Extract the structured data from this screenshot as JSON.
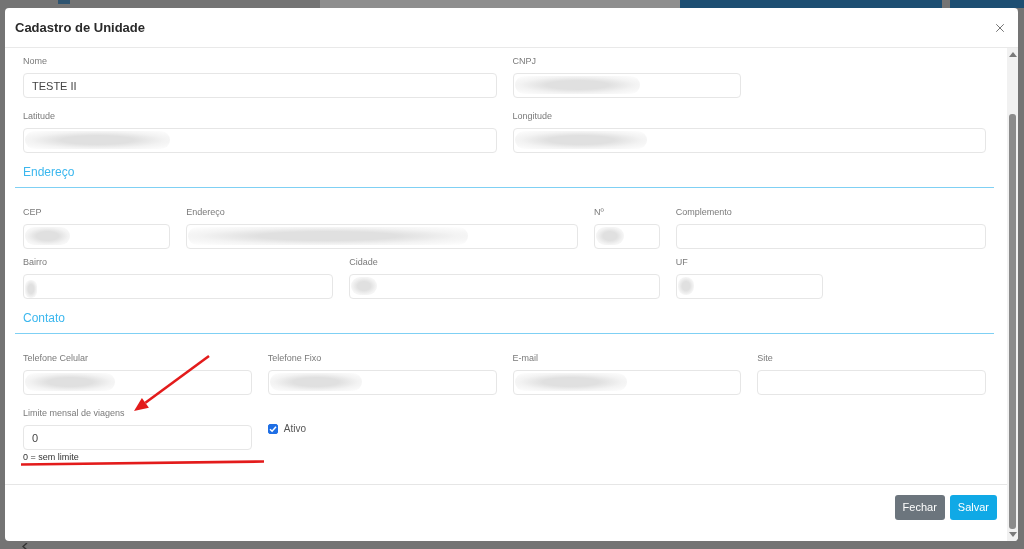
{
  "dialog": {
    "title": "Cadastro de Unidade"
  },
  "groups": [
    {
      "fields": [
        {
          "kind": "text",
          "label": "Nome",
          "value": "TESTE II",
          "blurred": false
        },
        {
          "kind": "text",
          "label": "CNPJ",
          "blurred": true
        },
        {
          "kind": "text",
          "label": "Latitude",
          "blurred": true
        },
        {
          "kind": "text",
          "label": "Longitude",
          "blurred": true
        }
      ]
    },
    {
      "title": "Endereço",
      "fields": [
        {
          "kind": "text",
          "label": "CEP",
          "blurred": true
        },
        {
          "kind": "text",
          "label": "Endereço",
          "blurred": true
        },
        {
          "kind": "text",
          "label": "Nº",
          "blurred": true
        },
        {
          "kind": "text",
          "label": "Complemento",
          "blurred": false
        },
        {
          "kind": "text",
          "label": "Bairro",
          "blurred": true
        },
        {
          "kind": "text",
          "label": "Cidade",
          "blurred": true
        },
        {
          "kind": "text",
          "label": "UF",
          "blurred": true
        }
      ]
    },
    {
      "title": "Contato",
      "fields": [
        {
          "kind": "text",
          "label": "Telefone Celular",
          "blurred": true
        },
        {
          "kind": "text",
          "label": "Telefone Fixo",
          "blurred": true
        },
        {
          "kind": "text",
          "label": "E-mail",
          "blurred": true
        },
        {
          "kind": "text",
          "label": "Site",
          "blurred": false
        },
        {
          "kind": "text",
          "label": "Limite mensal de viagens",
          "value": "0",
          "hint": "0 = sem limite",
          "blurred": false
        },
        {
          "kind": "checkbox",
          "label": "Ativo",
          "checked": true
        }
      ]
    }
  ],
  "buttons": [
    {
      "label": "Fechar",
      "kind": "secondary"
    },
    {
      "label": "Salvar",
      "kind": "primary"
    }
  ],
  "annotations": [
    {
      "kind": "arrow"
    },
    {
      "kind": "underline"
    }
  ]
}
